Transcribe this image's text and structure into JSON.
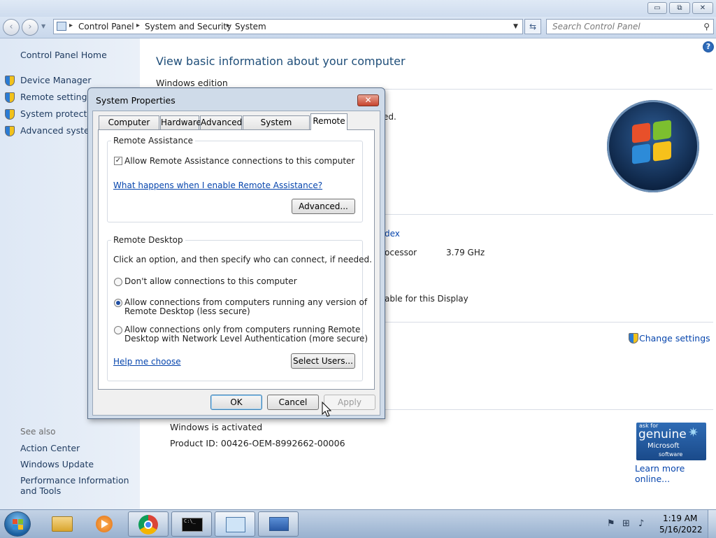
{
  "window": {
    "minimize_glyph": "▭",
    "maximize_glyph": "⧉",
    "close_glyph": "✕"
  },
  "address": {
    "back_glyph": "‹",
    "forward_glyph": "›",
    "crumbs": [
      "Control Panel",
      "System and Security",
      "System"
    ],
    "search_placeholder": "Search Control Panel"
  },
  "left_pane": {
    "home": "Control Panel Home",
    "links": [
      "Device Manager",
      "Remote settings",
      "System protection",
      "Advanced system settings"
    ],
    "see_also_title": "See also",
    "see_also": [
      "Action Center",
      "Windows Update",
      "Performance Information and Tools"
    ]
  },
  "main": {
    "title": "View basic information about your computer",
    "windows_edition": "Windows edition",
    "partial_1": "ed.",
    "partial_2": "dex",
    "partial_3": "ocessor",
    "processor_speed": "3.79 GHz",
    "partial_4": "able for this Display",
    "change_settings": "Change settings",
    "activation_status": "Windows is activated",
    "product_id": "Product ID: 00426-OEM-8992662-00006",
    "genuine_badge": {
      "line1": "ask for",
      "line2": "genuine",
      "line3": "Microsoft",
      "line4": "software"
    },
    "learn_more": "Learn more online..."
  },
  "dialog": {
    "title": "System Properties",
    "tabs": [
      "Computer Name",
      "Hardware",
      "Advanced",
      "System Protection",
      "Remote"
    ],
    "active_tab": "Remote",
    "remote_assistance": {
      "group_title": "Remote Assistance",
      "checkbox_label": "Allow Remote Assistance connections to this computer",
      "checkbox_checked": true,
      "help_link": "What happens when I enable Remote Assistance?",
      "advanced_button": "Advanced..."
    },
    "remote_desktop": {
      "group_title": "Remote Desktop",
      "instruction": "Click an option, and then specify who can connect, if needed.",
      "option_1": "Don't allow connections to this computer",
      "option_2_line1": "Allow connections from computers running any version of",
      "option_2_line2": "Remote Desktop (less secure)",
      "option_3_line1": "Allow connections only from computers running Remote",
      "option_3_line2": "Desktop with Network Level Authentication (more secure)",
      "selected_option": 2,
      "help_link": "Help me choose",
      "select_users_button": "Select Users..."
    },
    "buttons": {
      "ok": "OK",
      "cancel": "Cancel",
      "apply": "Apply"
    }
  },
  "taskbar": {
    "clock_time": "1:19 AM",
    "clock_date": "5/16/2022",
    "cmd_prompt_text": "C:\\_"
  },
  "colors": {
    "link_blue": "#0645ad",
    "title_blue": "#1f4e79",
    "dialog_frame": "#cfdbe9"
  }
}
